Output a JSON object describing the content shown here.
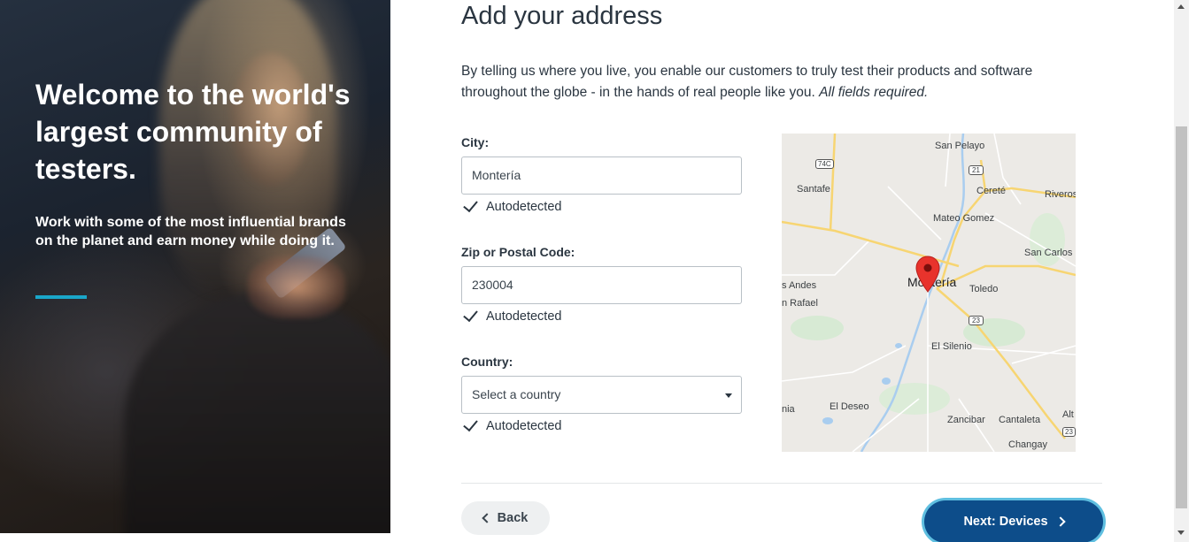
{
  "hero": {
    "title": "Welcome to the world's largest community of testers.",
    "subtitle": "Work with some of the most influential brands on the planet and earn money while doing it.",
    "accent_color": "#1aa6c9"
  },
  "form": {
    "heading": "Add your address",
    "intro": "By telling us where you live, you enable our customers to truly test their products and software throughout the globe - in the hands of real people like you.",
    "intro_emphasis": "All fields required.",
    "city": {
      "label": "City:",
      "value": "Montería",
      "status": "Autodetected"
    },
    "zip": {
      "label": "Zip or Postal Code:",
      "value": "230004",
      "status": "Autodetected"
    },
    "country": {
      "label": "Country:",
      "placeholder": "Select a country",
      "status": "Autodetected"
    }
  },
  "map": {
    "marker_icon": "map-pin-icon",
    "labels": {
      "san_pelayo": "San Pelayo",
      "santafe": "Santafe",
      "cerete": "Cereté",
      "riveros": "Riveros",
      "mateo_gomez": "Mateo Gomez",
      "san_carlos": "San Carlos",
      "monteria": "Montería",
      "toledo": "Toledo",
      "s_andes": "s Andes",
      "n_rafael": "n Rafael",
      "el_silenio": "El Silenio",
      "el_deseo": "El Deseo",
      "nia": "nia",
      "zancibar": "Zancibar",
      "cantaleta": "Cantaleta",
      "alt": "Alt",
      "changay": "Changay"
    },
    "shields": {
      "r74c": "74C",
      "r21": "21",
      "r23a": "23",
      "r23b": "23"
    }
  },
  "nav": {
    "back_label": "Back",
    "next_label": "Next: Devices",
    "next_color": "#0d4d8a"
  }
}
